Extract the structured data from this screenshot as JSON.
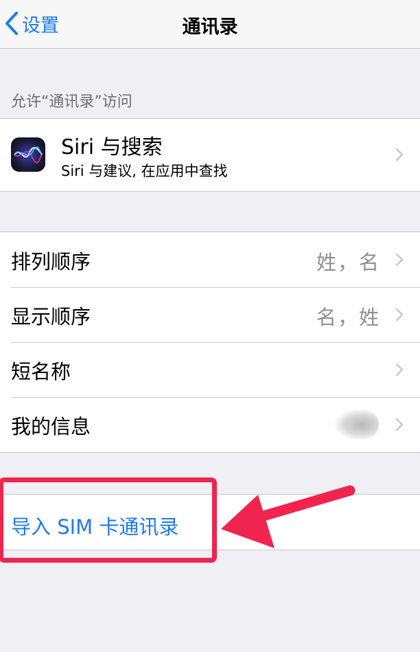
{
  "navbar": {
    "back_label": "设置",
    "title": "通讯录"
  },
  "section": {
    "header": "允许“通讯录”访问"
  },
  "siri": {
    "title": "Siri 与搜索",
    "subtitle": "Siri 与建议, 在应用中查找"
  },
  "settings": {
    "items": [
      {
        "label": "排列顺序",
        "value": "姓，名"
      },
      {
        "label": "显示顺序",
        "value": "名，姓"
      },
      {
        "label": "短名称",
        "value": ""
      },
      {
        "label": "我的信息",
        "value": ""
      }
    ]
  },
  "sim": {
    "label": "导入 SIM 卡通讯录"
  },
  "colors": {
    "accent": "#1f7aeb",
    "highlight": "#f0244f"
  },
  "icons": [
    "chevron-left-icon",
    "siri-icon",
    "chevron-right-icon",
    "arrow-icon"
  ]
}
